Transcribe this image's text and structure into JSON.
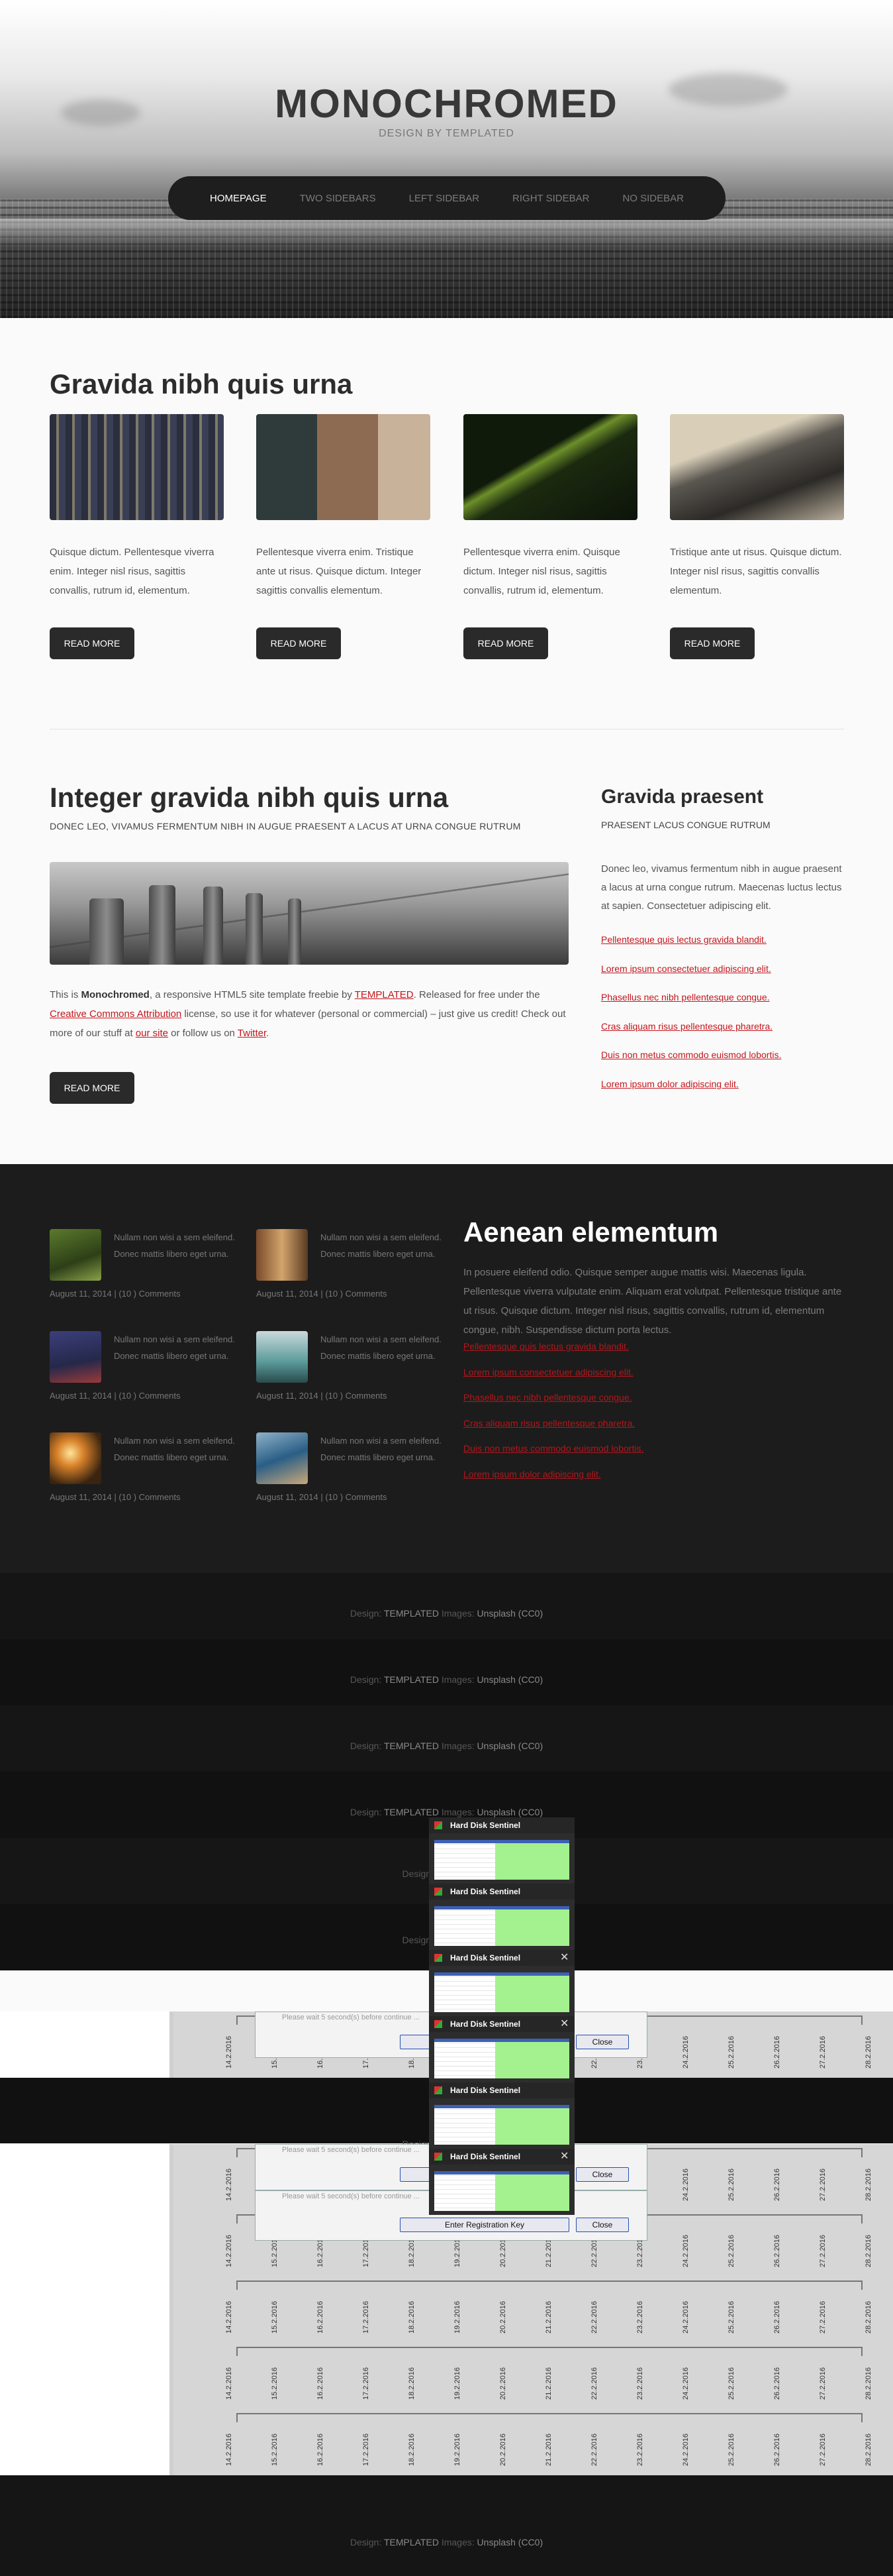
{
  "header": {
    "title": "MONOCHROMED",
    "subtitle": "DESIGN BY TEMPLATED"
  },
  "nav": {
    "items": [
      "HOMEPAGE",
      "TWO SIDEBARS",
      "LEFT SIDEBAR",
      "RIGHT SIDEBAR",
      "NO SIDEBAR"
    ],
    "active": "HOMEPAGE"
  },
  "features": {
    "title": "Gravida nibh quis urna",
    "items": [
      {
        "text": "Quisque dictum. Pellentesque viverra enim. Integer nisl risus, sagittis convallis, rutrum id, elementum.",
        "button": "READ MORE"
      },
      {
        "text": "Pellentesque viverra enim. Tristique ante ut risus. Quisque dictum. Integer sagittis convallis elementum.",
        "button": "READ MORE"
      },
      {
        "text": "Pellentesque viverra enim. Quisque dictum. Integer nisl risus, sagittis convallis, rutrum id, elementum.",
        "button": "READ MORE"
      },
      {
        "text": "Tristique ante ut risus. Quisque dictum. Integer nisl risus, sagittis convallis elementum.",
        "button": "READ MORE"
      }
    ]
  },
  "main": {
    "title": "Integer gravida nibh quis urna",
    "subtitle": "DONEC LEO, VIVAMUS FERMENTUM NIBH IN AUGUE PRAESENT A LACUS AT URNA CONGUE RUTRUM",
    "body_1": "This is ",
    "body_bold": "Monochromed",
    "body_2": ", a responsive HTML5 site template freebie by ",
    "link_templated": "TEMPLATED",
    "body_3": ". Released for free under the ",
    "link_license": "Creative Commons Attribution",
    "body_4": " license, so use it for whatever (personal or commercial) – just give us credit! Check out more of our stuff at ",
    "link_site": "our site",
    "body_5": " or follow us on ",
    "link_twitter": "Twitter",
    "body_6": ".",
    "button": "READ MORE"
  },
  "sidebar": {
    "title": "Gravida praesent",
    "subtitle": "PRAESENT LACUS CONGUE RUTRUM",
    "body": "Donec leo, vivamus fermentum nibh in augue praesent a lacus at urna congue rutrum. Maecenas luctus lectus at sapien. Consectetuer adipiscing elit.",
    "links": [
      "Pellentesque quis lectus gravida blandit.",
      "Lorem ipsum consectetuer adipiscing elit.",
      "Phasellus nec nibh pellentesque congue.",
      "Cras aliquam risus pellentesque pharetra.",
      "Duis non metus commodo euismod lobortis.",
      "Lorem ipsum dolor adipiscing elit."
    ]
  },
  "dark": {
    "posts": [
      {
        "text": "Nullam non wisi a sem eleifend. Donec mattis libero eget urna.",
        "meta": "August 11, 2014 | (10 ) Comments"
      },
      {
        "text": "Nullam non wisi a sem eleifend. Donec mattis libero eget urna.",
        "meta": "August 11, 2014 | (10 ) Comments"
      },
      {
        "text": "Nullam non wisi a sem eleifend. Donec mattis libero eget urna.",
        "meta": "August 11, 2014 | (10 ) Comments"
      },
      {
        "text": "Nullam non wisi a sem eleifend. Donec mattis libero eget urna.",
        "meta": "August 11, 2014 | (10 ) Comments"
      },
      {
        "text": "Nullam non wisi a sem eleifend. Donec mattis libero eget urna.",
        "meta": "August 11, 2014 | (10 ) Comments"
      },
      {
        "text": "Nullam non wisi a sem eleifend. Donec mattis libero eget urna.",
        "meta": "August 11, 2014 | (10 ) Comments"
      }
    ],
    "title": "Aenean elementum",
    "body": "In posuere eleifend odio. Quisque semper augue mattis wisi. Maecenas ligula. Pellentesque viverra vulputate enim. Aliquam erat volutpat. Pellentesque tristique ante ut risus. Quisque dictum. Integer nisl risus, sagittis convallis, rutrum id, elementum congue, nibh. Suspendisse dictum porta lectus.",
    "links": [
      "Pellentesque quis lectus gravida blandit.",
      "Lorem ipsum consectetuer adipiscing elit.",
      "Phasellus nec nibh pellentesque congue.",
      "Cras aliquam risus pellentesque pharetra.",
      "Duis non metus commodo euismod lobortis.",
      "Lorem ipsum dolor adipiscing elit."
    ]
  },
  "footer": {
    "design_label": "Design:",
    "design_link": "TEMPLATED",
    "images_label": "Images:",
    "images_link": "Unsplash (CC0)"
  },
  "popup": {
    "window_title": "Hard Disk Sentinel",
    "dialog_text": "Please wait 5 second(s) before continue ...",
    "register_button": "Enter Registration Key",
    "close_button": "Close"
  },
  "timeline": {
    "dates": [
      "14.2.2016",
      "15.2.2016",
      "16.2.2016",
      "17.2.2016",
      "18.2.2016",
      "19.2.2016",
      "20.2.2016",
      "21.2.2016",
      "22.2.2016",
      "23.2.2016",
      "24.2.2016",
      "25.2.2016",
      "26.2.2016",
      "27.2.2016",
      "28.2.2016"
    ]
  }
}
